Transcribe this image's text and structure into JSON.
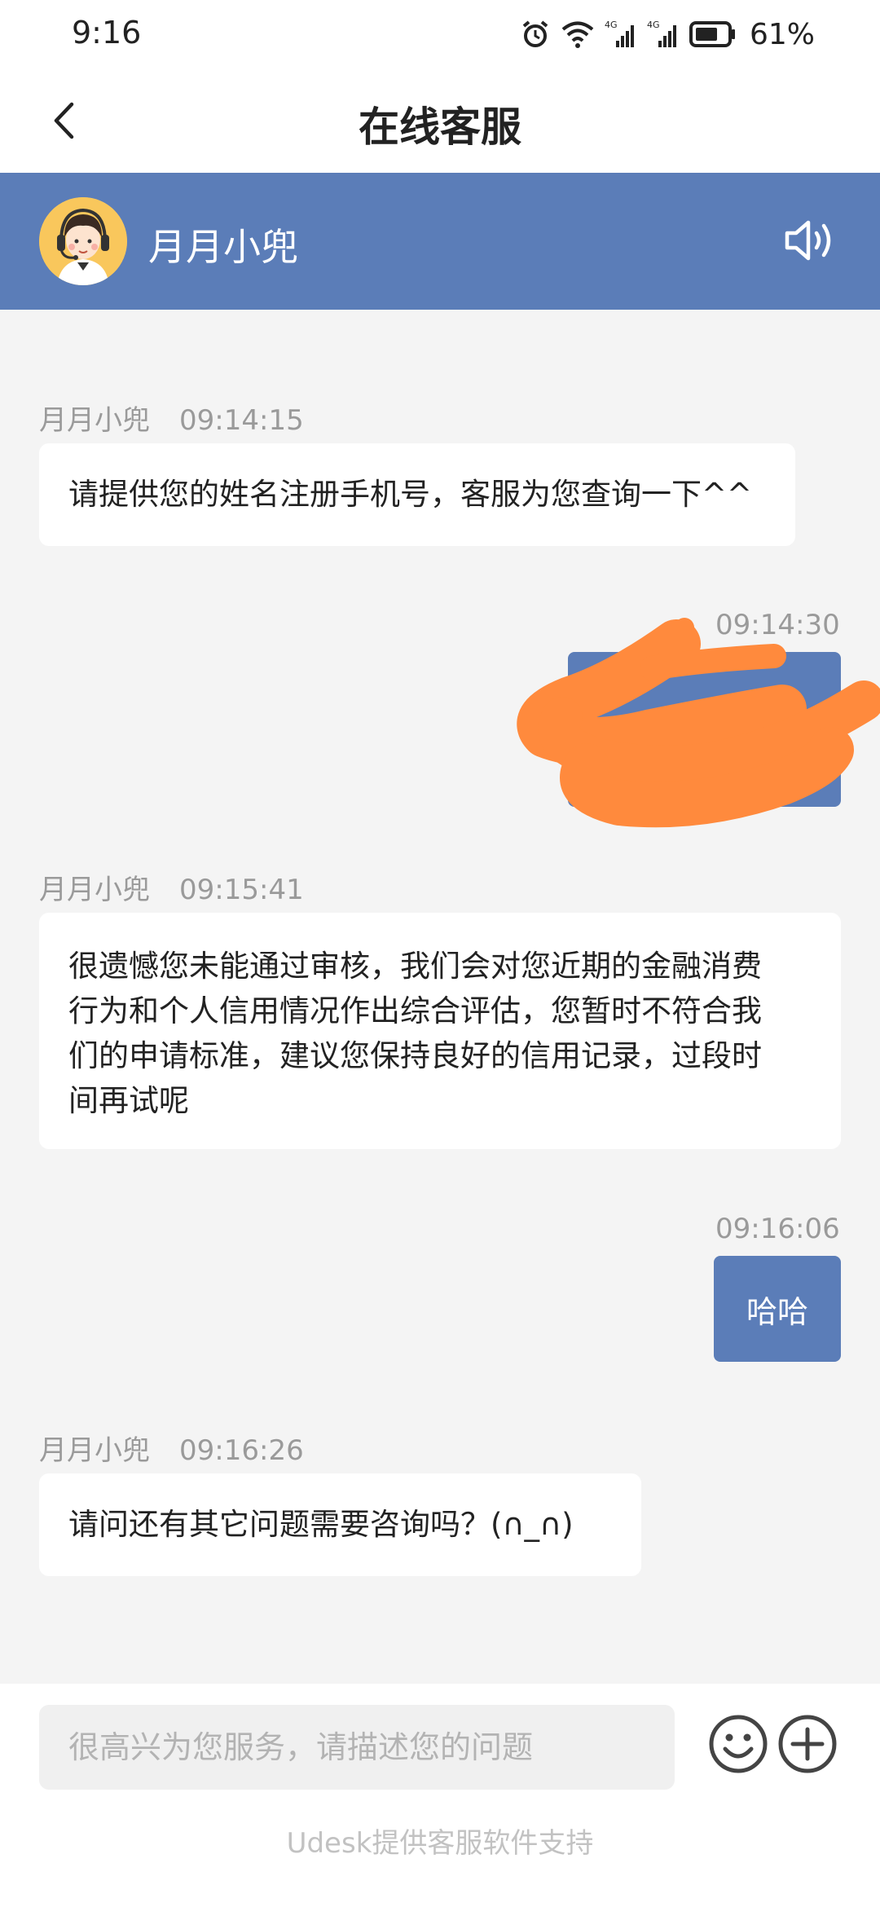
{
  "status_bar": {
    "time": "9:16",
    "battery": "61%",
    "icons": [
      "alarm-icon",
      "wifi-icon",
      "signal-4g-icon",
      "signal-4g-icon",
      "battery-icon"
    ]
  },
  "header": {
    "title": "在线客服",
    "back_icon": "chevron-left-icon"
  },
  "agent": {
    "name": "月月小兜",
    "avatar": "agent-avatar-headset",
    "speaker_icon": "speaker-icon",
    "band_color": "#5b7db8"
  },
  "messages": [
    {
      "from": "agent",
      "sender": "月月小兜",
      "time": "09:14:15",
      "lines": [
        "请提供您的姓名注册手机号，客服为您查询一下^^"
      ]
    },
    {
      "from": "user",
      "time": "09:14:30",
      "redacted": true
    },
    {
      "from": "agent",
      "sender": "月月小兜",
      "time": "09:15:41",
      "lines": [
        "很遗憾您未能通过审核，我们会对您近期的金融消费",
        "行为和个人信用情况作出综合评估，您暂时不符合我",
        "们的申请标准，建议您保持良好的信用记录，过段时",
        "间再试呢"
      ]
    },
    {
      "from": "user",
      "time": "09:16:06",
      "text": "哈哈"
    },
    {
      "from": "agent",
      "sender": "月月小兜",
      "time": "09:16:26",
      "lines": [
        "请问还有其它问题需要咨询吗？(∩_∩)"
      ]
    }
  ],
  "input": {
    "placeholder": "很高兴为您服务，请描述您的问题",
    "value": "",
    "emoji_icon": "emoji-icon",
    "plus_icon": "plus-circle-icon"
  },
  "footer": "Udesk提供客服软件支持",
  "colors": {
    "accent": "#5b7db8",
    "background": "#f4f4f4",
    "redaction": "#ff8a3d"
  }
}
